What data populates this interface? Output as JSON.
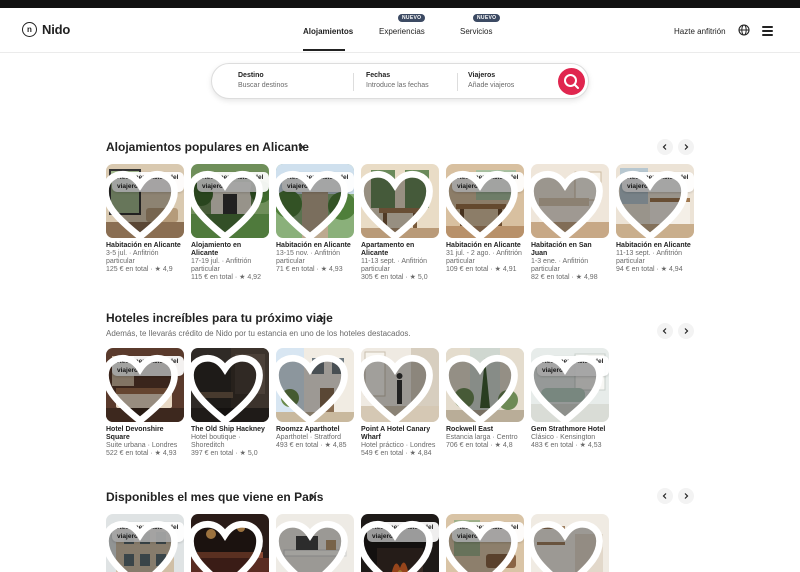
{
  "app": {
    "logo_text": "Nido",
    "logo_mark": "n"
  },
  "nav": {
    "tabs": [
      {
        "label": "Alojamientos",
        "badge": ""
      },
      {
        "label": "Experiencias",
        "badge": "NUEVO"
      },
      {
        "label": "Servicios",
        "badge": "NUEVO"
      }
    ],
    "host_link": "Hazte anfitrión"
  },
  "search": {
    "destination_label": "Destino",
    "destination_placeholder": "Buscar destinos",
    "dates_label": "Fechas",
    "dates_placeholder": "Introduce las fechas",
    "guests_label": "Viajeros",
    "guests_placeholder": "Añade viajeros"
  },
  "colors": {
    "accent": "#e0264f",
    "badge": "#3c4a63",
    "text": "#222222",
    "muted": "#6a6a6a"
  },
  "sections": [
    {
      "title": "Alojamientos populares en Alicante",
      "subtitle": "",
      "cards": [
        {
          "title": "Habitación en Alicante",
          "line1": "3-5 jul. · Anfitrión",
          "line2": "particular",
          "price": "125 € en total · ★ 4,9",
          "badge": "Recomendación del viajero",
          "scene": "living"
        },
        {
          "title": "Alojamiento en Alicante",
          "line1": "17-19 jul. · Anfitrión",
          "line2": "particular",
          "price": "115 € en total · ★ 4,92",
          "badge": "Recomendación del viajero",
          "scene": "garden"
        },
        {
          "title": "Habitación en Alicante",
          "line1": "13-15 nov. · Anfitrión",
          "line2": "particular",
          "price": "71 € en total · ★ 4,93",
          "badge": "Recomendación del viajero",
          "scene": "garden2"
        },
        {
          "title": "Apartamento en Alicante",
          "line1": "11-13 sept. · Anfitrión",
          "line2": "particular",
          "price": "305 € en total · ★ 5,0",
          "badge": "",
          "scene": "dining"
        },
        {
          "title": "Habitación en Alicante",
          "line1": "31 jul. - 2 ago. · Anfitrión",
          "line2": "particular",
          "price": "109 € en total · ★ 4,91",
          "badge": "Recomendación del viajero",
          "scene": "dining2"
        },
        {
          "title": "Habitación en San Juan",
          "line1": "1-3 ene. · Anfitrión",
          "line2": "particular",
          "price": "82 € en total · ★ 4,98",
          "badge": "",
          "scene": "bedroom"
        },
        {
          "title": "Habitación en Alicante",
          "line1": "11-13 sept. · Anfitrión",
          "line2": "particular",
          "price": "94 € en total · ★ 4,94",
          "badge": "Recomendación del viajero",
          "scene": "kitchen"
        }
      ]
    },
    {
      "title": "Hoteles increíbles para tu próximo viaje",
      "subtitle": "Además, te llevarás crédito de Nido por tu estancia en uno de los hoteles destacados.",
      "cards": [
        {
          "title": "Hotel Devonshire Square",
          "line1": "Suite urbana · Londres",
          "line2": "",
          "price": "522 € en total · ★ 4,93",
          "badge": "Recomendación del viajero",
          "scene": "suite"
        },
        {
          "title": "The Old Ship Hackney",
          "line1": "Hotel boutique ·",
          "line2": "Shoreditch",
          "price": "397 € en total · ★ 5,0",
          "badge": "",
          "scene": "pub"
        },
        {
          "title": "Roomzz Aparthotel",
          "line1": "Aparthotel · Stratford",
          "line2": "",
          "price": "493 € en total · ★ 4,85",
          "badge": "",
          "scene": "facade"
        },
        {
          "title": "Point A Hotel Canary Wharf",
          "line1": "Hotel práctico · Londres",
          "line2": "",
          "price": "549 € en total · ★ 4,84",
          "badge": "",
          "scene": "lobby"
        },
        {
          "title": "Rockwell East",
          "line1": "Estancia larga · Centro",
          "line2": "",
          "price": "706 € en total · ★ 4,8",
          "badge": "",
          "scene": "courtyard"
        },
        {
          "title": "Gem Strathmore Hotel",
          "line1": "Clásico · Kensington",
          "line2": "",
          "price": "483 € en total · ★ 4,53",
          "badge": "Recomendación del viajero",
          "scene": "spa"
        }
      ]
    },
    {
      "title": "Disponibles el mes que viene en París",
      "subtitle": "",
      "cards": [
        {
          "title": "",
          "line1": "",
          "line2": "",
          "price": "",
          "badge": "Recomendación del viajero",
          "scene": "building"
        },
        {
          "title": "",
          "line1": "",
          "line2": "",
          "price": "",
          "badge": "",
          "scene": "bar"
        },
        {
          "title": "",
          "line1": "",
          "line2": "",
          "price": "",
          "badge": "",
          "scene": "desk"
        },
        {
          "title": "",
          "line1": "",
          "line2": "",
          "price": "",
          "badge": "Recomendación del viajero",
          "scene": "fire"
        },
        {
          "title": "",
          "line1": "",
          "line2": "",
          "price": "",
          "badge": "Recomendación del viajero",
          "scene": "room"
        },
        {
          "title": "",
          "line1": "",
          "line2": "",
          "price": "",
          "badge": "",
          "scene": "shelf"
        }
      ]
    }
  ]
}
